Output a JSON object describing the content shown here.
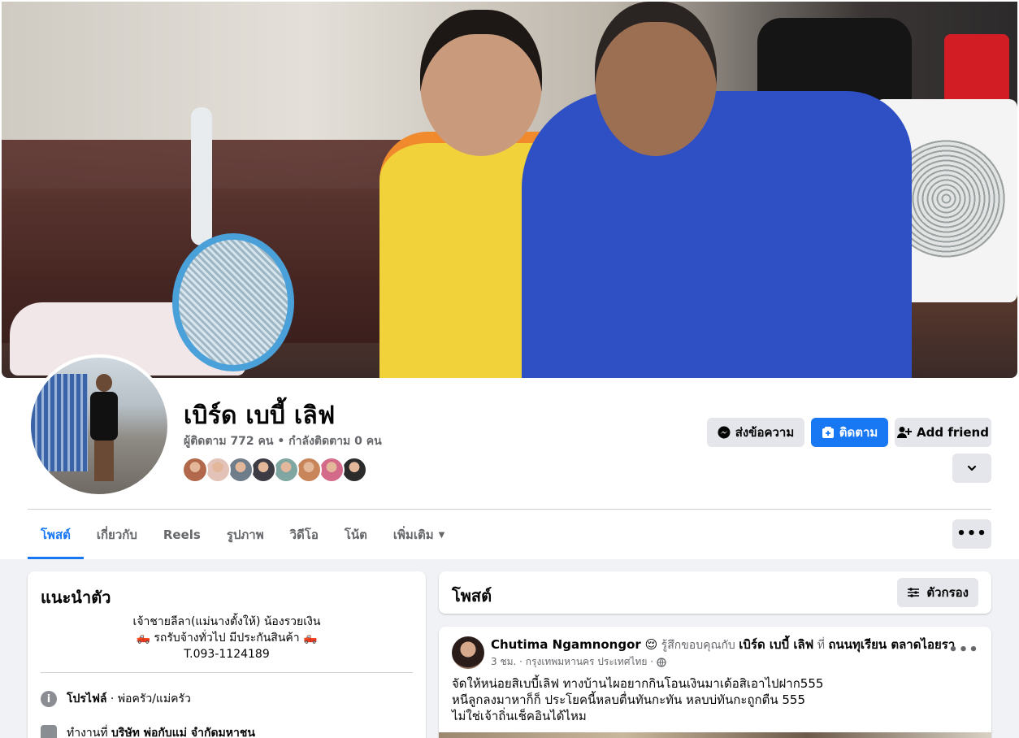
{
  "profile": {
    "name": "เบิร์ด เบบี้ เลิฟ",
    "stats": "ผู้ติดตาม 772 คน • กำลังติดตาม 0 คน",
    "friend_avatar_colors": [
      "#b2684a",
      "#e3c2b8",
      "#6f7c8a",
      "#3d3b43",
      "#7fa6a0",
      "#c9855a",
      "#d46a8a",
      "#2b2b2b"
    ]
  },
  "actions": {
    "message": "ส่งข้อความ",
    "follow": "ติดตาม",
    "add_friend": "Add friend"
  },
  "tabs": [
    {
      "label": "โพสต์",
      "active": true
    },
    {
      "label": "เกี่ยวกับ"
    },
    {
      "label": "Reels"
    },
    {
      "label": "รูปภาพ"
    },
    {
      "label": "วิดีโอ"
    },
    {
      "label": "โน้ต"
    },
    {
      "label": "เพิ่มเติม"
    }
  ],
  "intro": {
    "title": "แนะนำตัว",
    "bio_line1": "เจ้าชายลีลา(แม่นางตั้งให้) น้องรวยเงิน",
    "bio_line2": "🛻 รถรับจ้างทั่วไป มีประกันสินค้า 🛻",
    "bio_line3": "T.093-1124189",
    "profile_label": "โปรไฟล์",
    "profile_value": " · พ่อครัว/แม่ครัว",
    "work_prefix": "ทำงานที่ ",
    "work_value": "บริษัท พ่อกับแม่ จำกัดมหาชน"
  },
  "posts": {
    "title": "โพสต์",
    "filter": "ตัวกรอง"
  },
  "post": {
    "author": "Chutima Ngamnongor",
    "emoji": "😌",
    "feeling": " รู้สึกขอบคุณกับ ",
    "tagged": "เบิร์ด เบบี้ เลิฟ",
    "at": " ที่ ",
    "place": "ถนนทุเรียน ตลาดไอยรา",
    "meta": "3 ชม. · กรุงเทพมหานคร ประเทศไทย ·",
    "line1": "จัดให้หน่อยสิเบบี้เลิฟ ทางบ้านไผอยากกินโอนเงินมาเด้อสิเอาไปฝาก555",
    "line2": "หนีลูกลงมาหาก็ก็ ประโยคนี้หลบตื่นทันกะทัน หลบบ่ทันกะถูกตืน 555",
    "line3": "ไม่ใช่เจ้าถิ่นเช็คอินได้ไหม"
  },
  "colors": {
    "accent": "#1877f2",
    "background": "#f0f2f5",
    "secondary_button": "#e4e6eb"
  }
}
